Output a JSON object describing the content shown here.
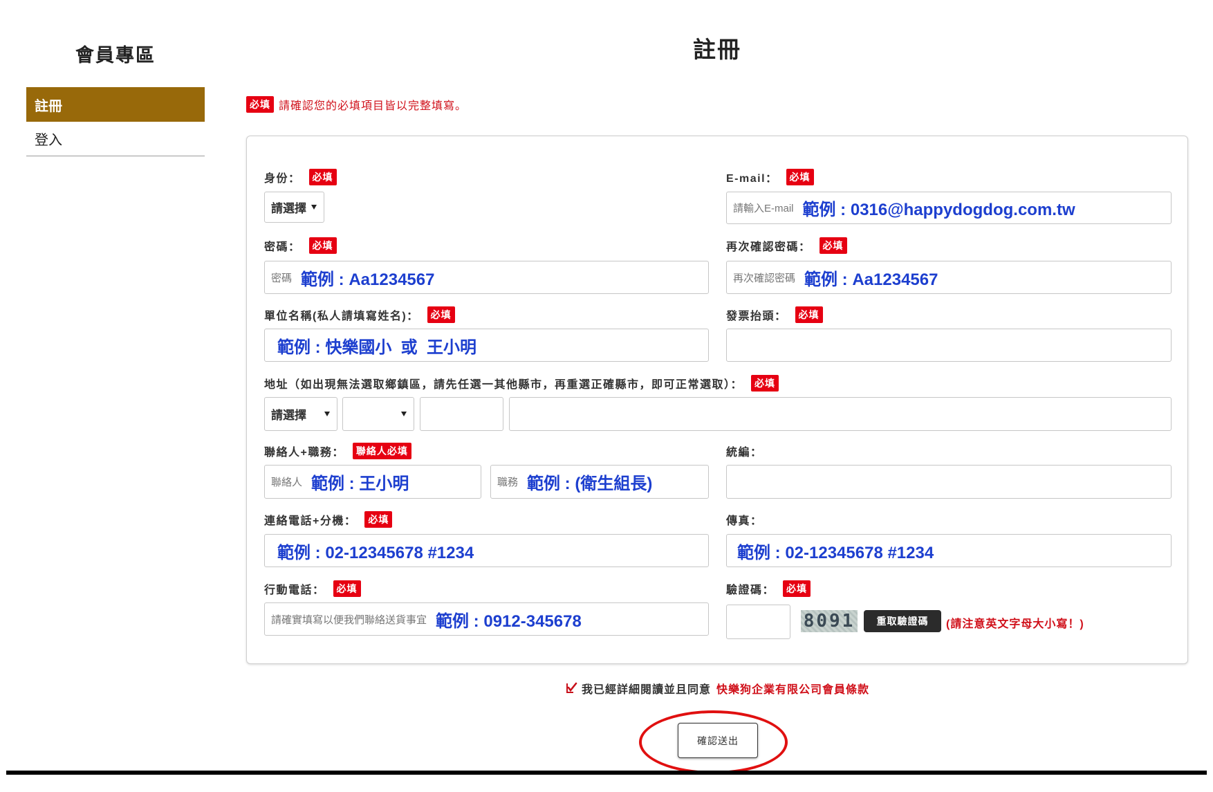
{
  "sidebar": {
    "title": "會員專區",
    "items": [
      {
        "label": "註冊",
        "active": true
      },
      {
        "label": "登入",
        "active": false
      }
    ]
  },
  "page": {
    "title": "註冊"
  },
  "notice": {
    "badge": "必填",
    "text": "請確認您的必填項目皆以完整填寫。"
  },
  "form": {
    "identity": {
      "label": "身份：",
      "badge": "必填",
      "value": "請選擇"
    },
    "email": {
      "label": "E-mail：",
      "badge": "必填",
      "placeholder": "請輸入E-mail",
      "example": "範例 : 0316@happydogdog.com.tw"
    },
    "password": {
      "label": "密碼：",
      "badge": "必填",
      "placeholder": "密碼",
      "example": "範例 : Aa1234567"
    },
    "password_confirm": {
      "label": "再次確認密碼：",
      "badge": "必填",
      "placeholder": "再次確認密碼",
      "example": "範例 : Aa1234567"
    },
    "organization": {
      "label": "單位名稱(私人請填寫姓名)：",
      "badge": "必填",
      "example": "範例 : 快樂國小  或  王小明"
    },
    "invoice_title": {
      "label": "發票抬頭：",
      "badge": "必填"
    },
    "address": {
      "label": "地址（如出現無法選取鄉鎮區，請先任選一其他縣市，再重選正確縣市，即可正常選取）：",
      "badge": "必填",
      "city_value": "請選擇"
    },
    "contact": {
      "label": "聯絡人+職務：",
      "badge": "聯絡人必填",
      "name_placeholder": "聯絡人",
      "name_example": "範例 : 王小明",
      "title_placeholder": "職務",
      "title_example": "範例 : (衛生組長)"
    },
    "tax_id": {
      "label": "統編："
    },
    "phone": {
      "label": "連絡電話+分機：",
      "badge": "必填",
      "example": "範例 : 02-12345678 #1234"
    },
    "fax": {
      "label": "傳真：",
      "example": "範例 : 02-12345678 #1234"
    },
    "mobile": {
      "label": "行動電話：",
      "badge": "必填",
      "placeholder": "請確實填寫以便我們聯絡送貨事宜",
      "example": "範例 : 0912-345678"
    },
    "captcha": {
      "label": "驗證碼：",
      "badge": "必填",
      "code": "8091",
      "refresh_label": "重取驗證碼",
      "note": "(請注意英文字母大小寫！)"
    }
  },
  "agreement": {
    "checked": true,
    "text": "我已經詳細閱讀並且同意",
    "link_text": "快樂狗企業有限公司會員條款"
  },
  "submit": {
    "label": "確認送出"
  },
  "icons": {
    "dropdown": "chevron-down-icon",
    "agreement_checkbox": "checkmark-icon"
  },
  "colors": {
    "accent": "#98690a",
    "required_badge": "#e60012",
    "example_text": "#1d3fcf",
    "highlight_circle": "#e01010",
    "link": "#d0101a"
  }
}
